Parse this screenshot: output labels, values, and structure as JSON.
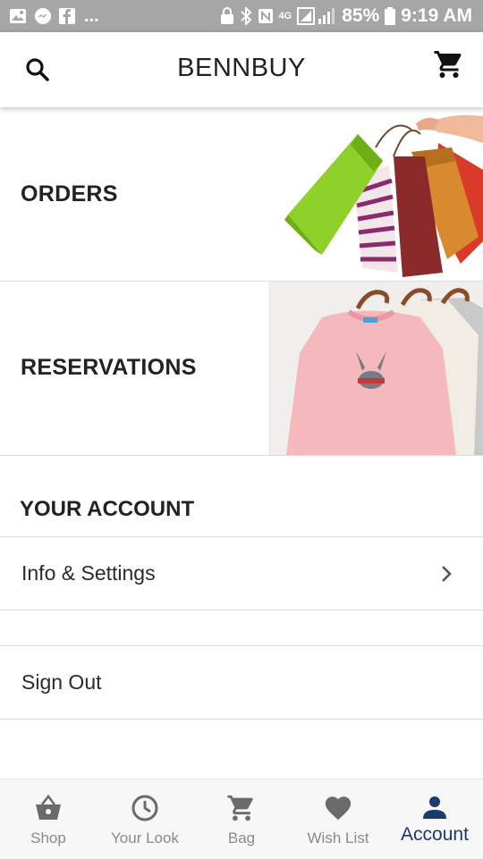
{
  "status_bar": {
    "battery": "85%",
    "time": "9:19 AM",
    "network": "4G",
    "overflow": "..."
  },
  "app_bar": {
    "title": "BENNBUY"
  },
  "features": [
    {
      "label": "ORDERS",
      "image": "shopping-bags"
    },
    {
      "label": "RESERVATIONS",
      "image": "sweaters-on-hangers"
    }
  ],
  "account": {
    "heading": "YOUR ACCOUNT",
    "info_settings": "Info & Settings",
    "sign_out": "Sign Out"
  },
  "bottom_nav": {
    "items": [
      {
        "label": "Shop",
        "icon": "basket-icon"
      },
      {
        "label": "Your Look",
        "icon": "clock-icon"
      },
      {
        "label": "Bag",
        "icon": "cart-icon"
      },
      {
        "label": "Wish List",
        "icon": "heart-icon"
      },
      {
        "label": "Account",
        "icon": "person-icon",
        "active": true
      }
    ]
  },
  "colors": {
    "status_bar": "#a6a6a6",
    "active_nav": "#1a3a6e",
    "inactive_nav": "#8a8a8a"
  }
}
